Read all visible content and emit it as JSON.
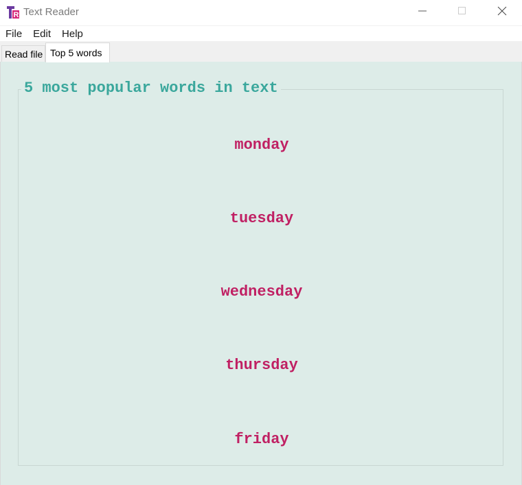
{
  "window": {
    "title": "Text Reader"
  },
  "menu": {
    "items": [
      "File",
      "Edit",
      "Help"
    ]
  },
  "tabs": [
    {
      "label": "Read file",
      "active": false
    },
    {
      "label": "Top 5 words",
      "active": true
    }
  ],
  "group": {
    "title": "5 most popular words in text",
    "words": [
      "monday",
      "tuesday",
      "wednesday",
      "thursday",
      "friday"
    ]
  },
  "colors": {
    "panel_background": "#ddece8",
    "group_title": "#3aa79c",
    "words": "#c02063",
    "app_icon_primary": "#6b3aa0",
    "app_icon_accent": "#d6287a"
  },
  "icons": {
    "app": "text-reader-app-icon",
    "minimize": "minimize-icon",
    "maximize": "maximize-icon",
    "close": "close-icon"
  }
}
